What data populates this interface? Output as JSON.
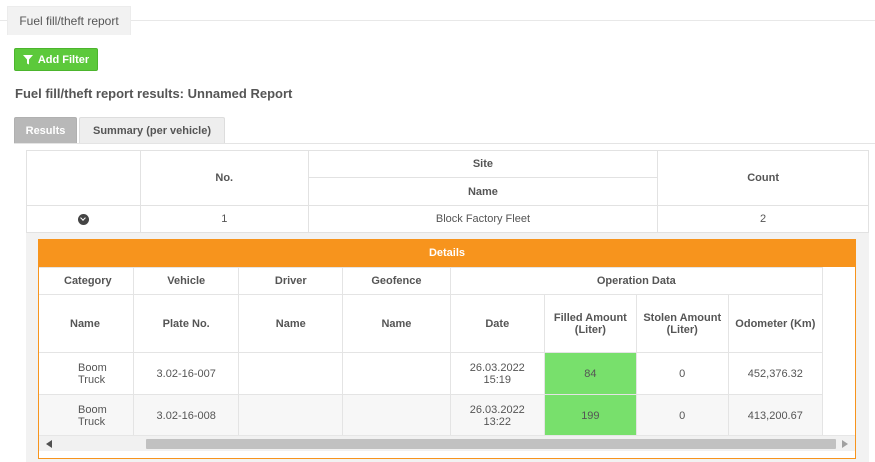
{
  "page_tab": {
    "label": "Fuel fill/theft report"
  },
  "toolbar": {
    "add_filter_label": "Add Filter"
  },
  "report": {
    "title": "Fuel fill/theft report results: Unnamed Report"
  },
  "tabs": [
    {
      "label": "Results",
      "active": true
    },
    {
      "label": "Summary (per vehicle)",
      "active": false
    }
  ],
  "outer_table": {
    "headers": {
      "no": "No.",
      "site": "Site",
      "site_name": "Name",
      "count": "Count"
    },
    "rows": [
      {
        "no": "1",
        "name": "Block Factory Fleet",
        "count": "2"
      }
    ]
  },
  "details": {
    "title": "Details",
    "group_headers": {
      "category": "Category",
      "vehicle": "Vehicle",
      "driver": "Driver",
      "geofence": "Geofence",
      "operation_data": "Operation Data"
    },
    "sub_headers": {
      "category_name": "Name",
      "plate_no": "Plate No.",
      "driver_name": "Name",
      "geofence_name": "Name",
      "date": "Date",
      "filled_amount": "Filled Amount (Liter)",
      "stolen_amount": "Stolen Amount (Liter)",
      "odometer": "Odometer (Km)"
    },
    "rows": [
      {
        "category": "Boom Truck",
        "plate": "3.02-16-007",
        "driver": "",
        "geofence": "",
        "date": "26.03.2022 15:19",
        "filled": "84",
        "stolen": "0",
        "odometer": "452,376.32"
      },
      {
        "category": "Boom Truck",
        "plate": "3.02-16-008",
        "driver": "",
        "geofence": "",
        "date": "26.03.2022 13:22",
        "filled": "199",
        "stolen": "0",
        "odometer": "413,200.67"
      }
    ]
  },
  "colors": {
    "accent_green": "#5cc93b",
    "details_orange": "#f7941d",
    "filled_highlight": "#78e06c"
  },
  "icons": {
    "filter": "filter-icon",
    "expand": "chevron-down-circle-icon",
    "scroll_left": "arrow-left-icon",
    "scroll_right": "arrow-right-icon"
  }
}
